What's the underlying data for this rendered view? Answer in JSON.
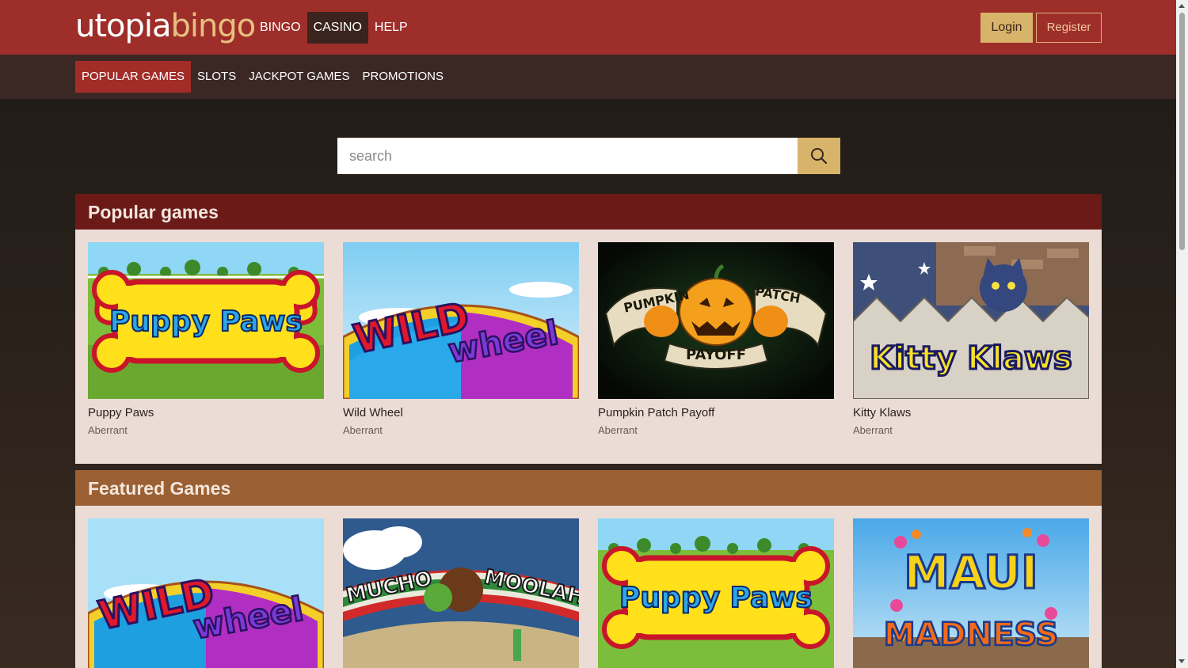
{
  "brand": {
    "logo_part1": "utopia",
    "logo_part2": "bingo"
  },
  "main_nav": [
    {
      "label": "BINGO",
      "active": false
    },
    {
      "label": "CASINO",
      "active": true
    },
    {
      "label": "HELP",
      "active": false
    }
  ],
  "auth": {
    "login_label": "Login",
    "register_label": "Register"
  },
  "sub_nav": [
    {
      "label": "POPULAR GAMES",
      "active": true
    },
    {
      "label": "SLOTS",
      "active": false
    },
    {
      "label": "JACKPOT GAMES",
      "active": false
    },
    {
      "label": "PROMOTIONS",
      "active": false
    }
  ],
  "search": {
    "placeholder": "search",
    "value": ""
  },
  "sections": [
    {
      "title": "Popular games",
      "games": [
        {
          "name": "Puppy Paws",
          "provider": "Aberrant",
          "art_text": [
            "Puppy Paws"
          ]
        },
        {
          "name": "Wild Wheel",
          "provider": "Aberrant",
          "art_text": [
            "WILD",
            "wheel"
          ]
        },
        {
          "name": "Pumpkin Patch Payoff",
          "provider": "Aberrant",
          "art_text": [
            "PUMPKIN",
            "PATCH",
            "PAYOFF"
          ]
        },
        {
          "name": "Kitty Klaws",
          "provider": "Aberrant",
          "art_text": [
            "Kitty Klaws"
          ]
        }
      ]
    },
    {
      "title": "Featured Games",
      "games": [
        {
          "name": "Wild Wheel",
          "art_text": [
            "WILD",
            "wheel"
          ]
        },
        {
          "name": "Mucho Moolah",
          "art_text": [
            "MUCHO",
            "MOOLAH"
          ]
        },
        {
          "name": "Puppy Paws",
          "art_text": [
            "Puppy Paws"
          ]
        },
        {
          "name": "Maui Madness",
          "art_text": [
            "MAUI",
            "MADNESS"
          ]
        }
      ]
    }
  ],
  "colors": {
    "topbar": "#9e2e2a",
    "subbar": "#3b2824",
    "accent_gold": "#d8b46a",
    "popular_header": "#6b1a18",
    "featured_header": "#9a6033",
    "card_panel": "#ecdcd6"
  }
}
